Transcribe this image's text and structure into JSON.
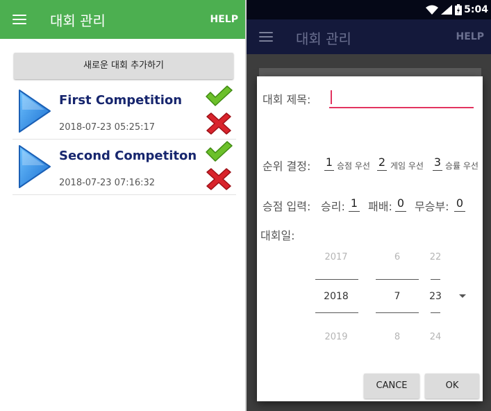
{
  "left": {
    "appbar": {
      "title": "대회 관리",
      "help": "HELP",
      "color": "#4caf50"
    },
    "add_button_label": "새로운 대회 추가하기",
    "competitions": [
      {
        "name": "First Competition",
        "date": "2018-07-23 05:25:17"
      },
      {
        "name": "Second Competiton",
        "date": "2018-07-23 07:16:32"
      }
    ],
    "icons": [
      "menu-icon",
      "play-icon",
      "check-icon",
      "delete-icon"
    ]
  },
  "right": {
    "status_bar": {
      "time": "5:04"
    },
    "appbar": {
      "title": "대회 관리",
      "help": "HELP"
    },
    "dialog": {
      "title_label": "대회 제목:",
      "title_value": "",
      "rank_label": "순위 결정:",
      "rank_order": [
        {
          "num": "1",
          "text": "승점 우선"
        },
        {
          "num": "2",
          "text": "게임 우선"
        },
        {
          "num": "3",
          "text": "승률 우선"
        }
      ],
      "points_label": "승점 입력:",
      "points": [
        {
          "label": "승리:",
          "value": "1"
        },
        {
          "label": "패배:",
          "value": "0"
        },
        {
          "label": "무승부:",
          "value": "0"
        }
      ],
      "date_label": "대회일:",
      "date_picker": {
        "year": {
          "prev": "2017",
          "selected": "2018",
          "next": "2019"
        },
        "month": {
          "prev": "6",
          "selected": "7",
          "next": "8"
        },
        "day": {
          "prev": "22",
          "selected": "23",
          "next": "24"
        }
      },
      "cancel_label": "CANCE",
      "ok_label": "OK",
      "accent_color": "#e2335f"
    }
  }
}
